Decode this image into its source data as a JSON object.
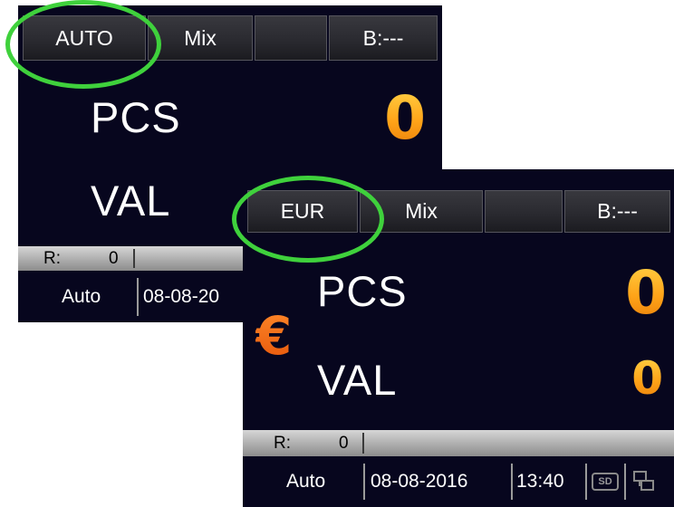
{
  "back_panel": {
    "tabs": [
      "AUTO",
      "Mix",
      "",
      "B:---"
    ],
    "pcs_label": "PCS",
    "pcs_value": "0",
    "val_label": "VAL",
    "r_label": "R:",
    "r_value": "0",
    "mode": "Auto",
    "date_partial": "08-08-20"
  },
  "front_panel": {
    "tabs": [
      "EUR",
      "Mix",
      "",
      "B:---"
    ],
    "currency_symbol": "€",
    "pcs_label": "PCS",
    "pcs_value": "0",
    "val_label": "VAL",
    "val_value": "0",
    "r_label": "R:",
    "r_value": "0",
    "mode": "Auto",
    "date": "08-08-2016",
    "time": "13:40",
    "sd_label": "SD"
  },
  "icons": {
    "sd": "sd-card-icon",
    "network": "network-icon"
  },
  "colors": {
    "screen_bg": "#07061e",
    "count_orange": "#ffa318",
    "euro_orange": "#e6550a",
    "highlight_ring": "#3fd13c"
  }
}
